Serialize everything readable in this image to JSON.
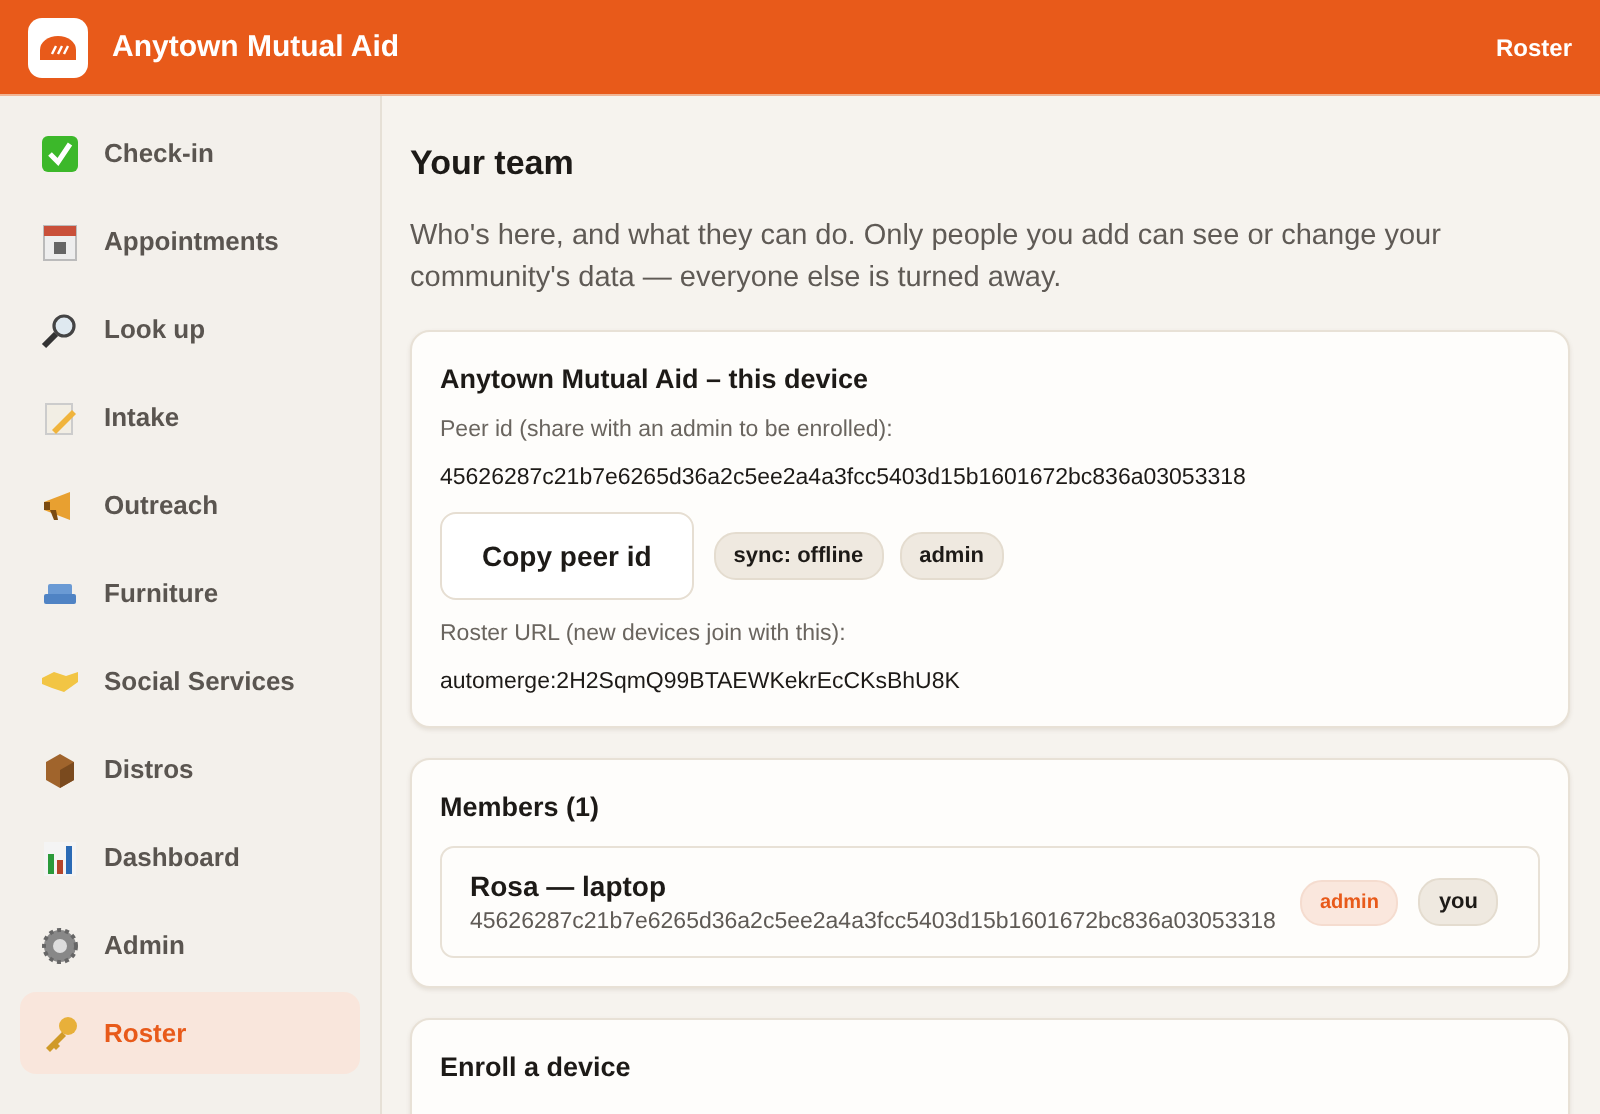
{
  "header": {
    "title": "Anytown Mutual Aid",
    "current_page": "Roster"
  },
  "sidebar": {
    "items": [
      {
        "label": "Check-in",
        "selected": false
      },
      {
        "label": "Appointments",
        "selected": false
      },
      {
        "label": "Look up",
        "selected": false
      },
      {
        "label": "Intake",
        "selected": false
      },
      {
        "label": "Outreach",
        "selected": false
      },
      {
        "label": "Furniture",
        "selected": false
      },
      {
        "label": "Social Services",
        "selected": false
      },
      {
        "label": "Distros",
        "selected": false
      },
      {
        "label": "Dashboard",
        "selected": false
      },
      {
        "label": "Admin",
        "selected": false
      },
      {
        "label": "Roster",
        "selected": true
      }
    ]
  },
  "main": {
    "heading": "Your team",
    "intro": "Who's here, and what they can do. Only people you add can see or change your community's data — everyone else is turned away.",
    "device_card": {
      "title": "Anytown Mutual Aid – this device",
      "peer_id_label": "Peer id (share with an admin to be enrolled):",
      "peer_id": "45626287c21b7e6265d36a2c5ee2a4a3fcc5403d15b1601672bc836a03053318",
      "copy_button": "Copy peer id",
      "tags": [
        {
          "label": "sync: offline",
          "kind": "plain"
        },
        {
          "label": "admin",
          "kind": "plain"
        }
      ],
      "roster_url_label": "Roster URL (new devices join with this):",
      "roster_url": "automerge:2H2SqmQ99BTAEWKekrEcCKsBhU8K"
    },
    "members_card": {
      "title": "Members (1)",
      "members": [
        {
          "name": "Rosa — laptop",
          "peer_id": "45626287c21b7e6265d36a2c5ee2a4a3fcc5403d15b1601672bc836a03053318",
          "tags": [
            {
              "label": "admin",
              "kind": "accent"
            },
            {
              "label": "you",
              "kind": "plain"
            }
          ]
        }
      ]
    },
    "enroll_card": {
      "title": "Enroll a device"
    }
  }
}
